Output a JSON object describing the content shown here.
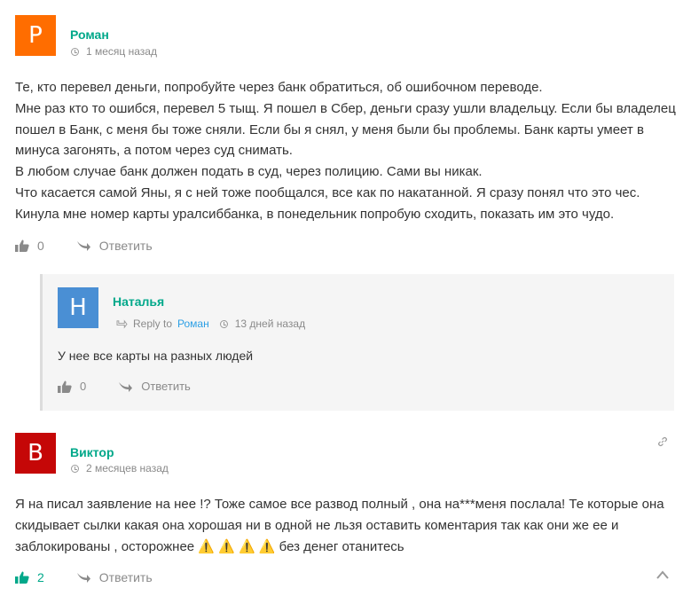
{
  "colors": {
    "accent": "#00a88a",
    "avatar_r": "#ff6d00",
    "avatar_h": "#4a8fd4",
    "avatar_b": "#c50707",
    "link": "#2c9fe5"
  },
  "comments": [
    {
      "avatar_letter": "Р",
      "author": "Роман",
      "time": "1 месяц назад",
      "lines": [
        "Те, кто перевел деньги, попробуйте через банк обратиться, об ошибочном переводе.",
        "Мне раз кто то ошибся, перевел 5 тыщ. Я пошел в Сбер, деньги сразу ушли владельцу. Если бы владелец",
        "пошел в Банк, с меня бы тоже сняли. Если бы я снял, у меня были бы проблемы. Банк карты умеет в",
        "минуса загонять, а потом через суд снимать.",
        "В любом случае банк должен подать в суд, через полицию. Сами вы никак.",
        "Что касается самой Яны, я с ней тоже пообщался, все как по накатанной. Я сразу понял что это чес.",
        "Кинула мне номер карты уралсиббанка, в понедельник попробую сходить, показать им это чудо."
      ],
      "likes": "0",
      "reply_label": "Ответить"
    },
    {
      "avatar_letter": "Н",
      "author": "Наталья",
      "reply_to_label": "Reply to",
      "reply_to_name": "Роман",
      "time": "13 дней назад",
      "text": "У нее все карты на разных людей",
      "likes": "0",
      "reply_label": "Ответить"
    },
    {
      "avatar_letter": "В",
      "author": "Виктор",
      "time": "2 месяцев назад",
      "lines": [
        "Я на писал заявление на нее !? Тоже самое все развод полный , она на***меня послала! Те которые она",
        "скидывает сылки какая она хорошая ни в одной не льзя оставить коментария так как они же ее и",
        "заблокированы , осторожнее ⚠️ ⚠️ ⚠️ ⚠️  без денег отанитесь"
      ],
      "likes": "2",
      "reply_label": "Ответить"
    }
  ],
  "icons": [
    "thumbs-up-icon",
    "reply-arrow-icon",
    "clock-icon",
    "link-icon",
    "chevron-up-icon"
  ]
}
